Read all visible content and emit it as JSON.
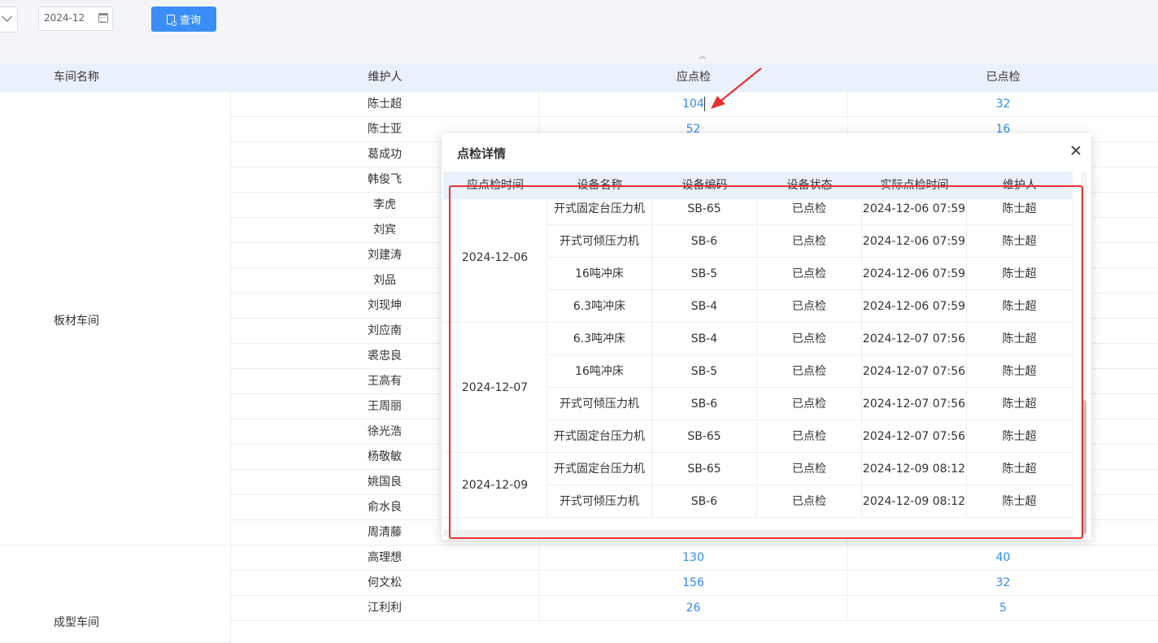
{
  "toolbar": {
    "date_value": "2024-12",
    "query_label": "查询"
  },
  "main_table": {
    "headers": [
      "车间名称",
      "维护人",
      "应点检",
      "已点检"
    ],
    "workshops": [
      "板材车间",
      "成型车间"
    ],
    "rows": [
      {
        "name": "陈士超",
        "due": "104",
        "done": "32"
      },
      {
        "name": "陈士亚",
        "due": "52",
        "done": "16"
      },
      {
        "name": "葛成功",
        "due": "",
        "done": ""
      },
      {
        "name": "韩俊飞",
        "due": "",
        "done": ""
      },
      {
        "name": "李虎",
        "due": "",
        "done": ""
      },
      {
        "name": "刘宾",
        "due": "",
        "done": ""
      },
      {
        "name": "刘建涛",
        "due": "",
        "done": ""
      },
      {
        "name": "刘品",
        "due": "",
        "done": ""
      },
      {
        "name": "刘现坤",
        "due": "",
        "done": ""
      },
      {
        "name": "刘应南",
        "due": "",
        "done": ""
      },
      {
        "name": "裘忠良",
        "due": "",
        "done": ""
      },
      {
        "name": "王高有",
        "due": "",
        "done": ""
      },
      {
        "name": "王周丽",
        "due": "",
        "done": ""
      },
      {
        "name": "徐光浩",
        "due": "",
        "done": ""
      },
      {
        "name": "杨敬敏",
        "due": "",
        "done": ""
      },
      {
        "name": "姚国良",
        "due": "",
        "done": ""
      },
      {
        "name": "俞水良",
        "due": "",
        "done": ""
      },
      {
        "name": "周清藤",
        "due": "",
        "done": ""
      },
      {
        "name": "高理想",
        "due": "130",
        "done": "40"
      },
      {
        "name": "何文松",
        "due": "156",
        "done": "32"
      },
      {
        "name": "江利利",
        "due": "26",
        "done": "5"
      }
    ]
  },
  "modal": {
    "title": "点检详情",
    "headers": [
      "应点检时间",
      "设备名称",
      "设备编码",
      "设备状态",
      "实际点检时间",
      "维护人"
    ],
    "groups": [
      {
        "date": "2024-12-06",
        "rows": [
          {
            "device": "开式固定台压力机",
            "code": "SB-65",
            "status": "已点检",
            "time": "2024-12-06 07:59",
            "person": "陈士超"
          },
          {
            "device": "开式可倾压力机",
            "code": "SB-6",
            "status": "已点检",
            "time": "2024-12-06 07:59",
            "person": "陈士超"
          },
          {
            "device": "16吨冲床",
            "code": "SB-5",
            "status": "已点检",
            "time": "2024-12-06 07:59",
            "person": "陈士超"
          },
          {
            "device": "6.3吨冲床",
            "code": "SB-4",
            "status": "已点检",
            "time": "2024-12-06 07:59",
            "person": "陈士超"
          }
        ]
      },
      {
        "date": "2024-12-07",
        "rows": [
          {
            "device": "6.3吨冲床",
            "code": "SB-4",
            "status": "已点检",
            "time": "2024-12-07 07:56",
            "person": "陈士超"
          },
          {
            "device": "16吨冲床",
            "code": "SB-5",
            "status": "已点检",
            "time": "2024-12-07 07:56",
            "person": "陈士超"
          },
          {
            "device": "开式可倾压力机",
            "code": "SB-6",
            "status": "已点检",
            "time": "2024-12-07 07:56",
            "person": "陈士超"
          },
          {
            "device": "开式固定台压力机",
            "code": "SB-65",
            "status": "已点检",
            "time": "2024-12-07 07:56",
            "person": "陈士超"
          }
        ]
      },
      {
        "date": "2024-12-09",
        "rows": [
          {
            "device": "开式固定台压力机",
            "code": "SB-65",
            "status": "已点检",
            "time": "2024-12-09 08:12",
            "person": "陈士超"
          },
          {
            "device": "开式可倾压力机",
            "code": "SB-6",
            "status": "已点检",
            "time": "2024-12-09 08:12",
            "person": "陈士超"
          }
        ]
      }
    ]
  },
  "colors": {
    "accent": "#3a8ef6",
    "link": "#2d8cf0",
    "highlight_box": "#e8312f",
    "header_bg": "#eaf1fb"
  }
}
